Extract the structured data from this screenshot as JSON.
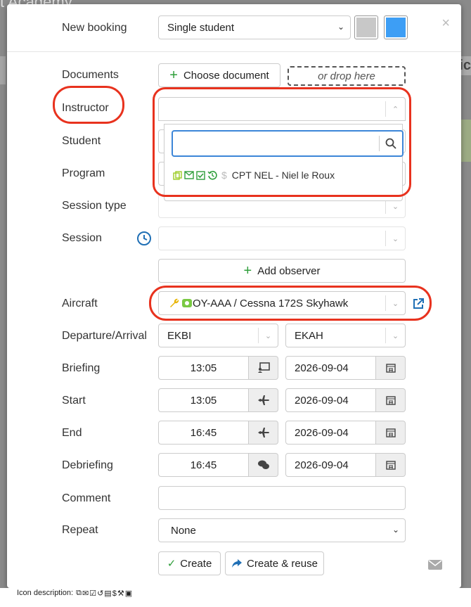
{
  "background": {
    "title": "t Academy",
    "right_text": "ric"
  },
  "header": {
    "label": "New booking",
    "booking_type": "Single student",
    "colors": [
      "#c8c8c8",
      "#3d9ef5"
    ]
  },
  "documents": {
    "label": "Documents",
    "choose_label": "Choose document",
    "drop_label": "or drop here"
  },
  "instructor": {
    "label": "Instructor",
    "value": "",
    "search_value": "",
    "option_label": "CPT NEL - Niel le Roux",
    "option_icons": [
      "copy-icon",
      "envelope-icon",
      "check-square-icon",
      "history-icon",
      "dollar-icon"
    ]
  },
  "student": {
    "label": "Student"
  },
  "program": {
    "label": "Program"
  },
  "session_type": {
    "label": "Session type"
  },
  "session": {
    "label": "Session",
    "icon": "clock-icon"
  },
  "observer": {
    "add_label": "Add observer"
  },
  "aircraft": {
    "label": "Aircraft",
    "value": "OY-AAA / Cessna 172S Skyhawk",
    "icons": [
      "wrench-icon",
      "service-icon"
    ]
  },
  "departure_arrival": {
    "label": "Departure/Arrival",
    "departure": "EKBI",
    "arrival": "EKAH"
  },
  "briefing": {
    "label": "Briefing",
    "time": "13:05",
    "date": "2026-09-04"
  },
  "start": {
    "label": "Start",
    "time": "13:05",
    "date": "2026-09-04"
  },
  "end": {
    "label": "End",
    "time": "16:45",
    "date": "2026-09-04"
  },
  "debriefing": {
    "label": "Debriefing",
    "time": "16:45",
    "date": "2026-09-04"
  },
  "comment": {
    "label": "Comment",
    "value": ""
  },
  "repeat": {
    "label": "Repeat",
    "value": "None"
  },
  "actions": {
    "create_label": "Create",
    "create_reuse_label": "Create & reuse"
  },
  "footer": {
    "icon_description_label": "Icon description:"
  }
}
